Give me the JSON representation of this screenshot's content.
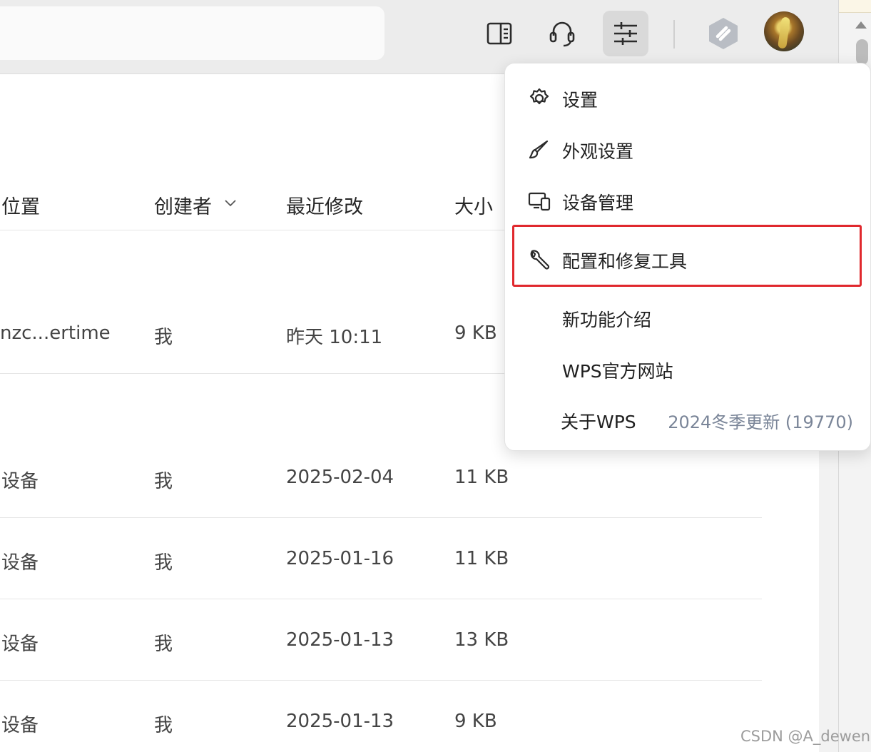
{
  "table": {
    "headers": {
      "location": "位置",
      "creator": "创建者",
      "modified": "最近修改",
      "size": "大小"
    },
    "rows": [
      {
        "location": "nzc...ertime",
        "creator": "我",
        "modified": "昨天 10:11",
        "size": "9 KB"
      },
      {
        "location": "设备",
        "creator": "我",
        "modified": "2025-02-04",
        "size": "11 KB"
      },
      {
        "location": "设备",
        "creator": "我",
        "modified": "2025-01-16",
        "size": "11 KB"
      },
      {
        "location": "设备",
        "creator": "我",
        "modified": "2025-01-13",
        "size": "13 KB"
      },
      {
        "location": "设备",
        "creator": "我",
        "modified": "2025-01-13",
        "size": "9 KB"
      }
    ]
  },
  "menu": {
    "items": [
      {
        "label": "设置",
        "icon": "gear-icon"
      },
      {
        "label": "外观设置",
        "icon": "brush-icon"
      },
      {
        "label": "设备管理",
        "icon": "devices-icon"
      },
      {
        "label": "配置和修复工具",
        "icon": "wrench-icon"
      },
      {
        "label": "新功能介绍"
      },
      {
        "label": "WPS官方网站"
      },
      {
        "label": "关于WPS"
      }
    ],
    "version": "2024冬季更新 (19770)"
  },
  "toolbar": {
    "icons": [
      "sidebar-panel-icon",
      "headset-icon",
      "settings-sliders-icon",
      "app-logo-icon",
      "avatar"
    ]
  },
  "watermark": "CSDN @A_dewen",
  "colors": {
    "highlight": "#e0282d",
    "version_text": "#7a8598"
  }
}
